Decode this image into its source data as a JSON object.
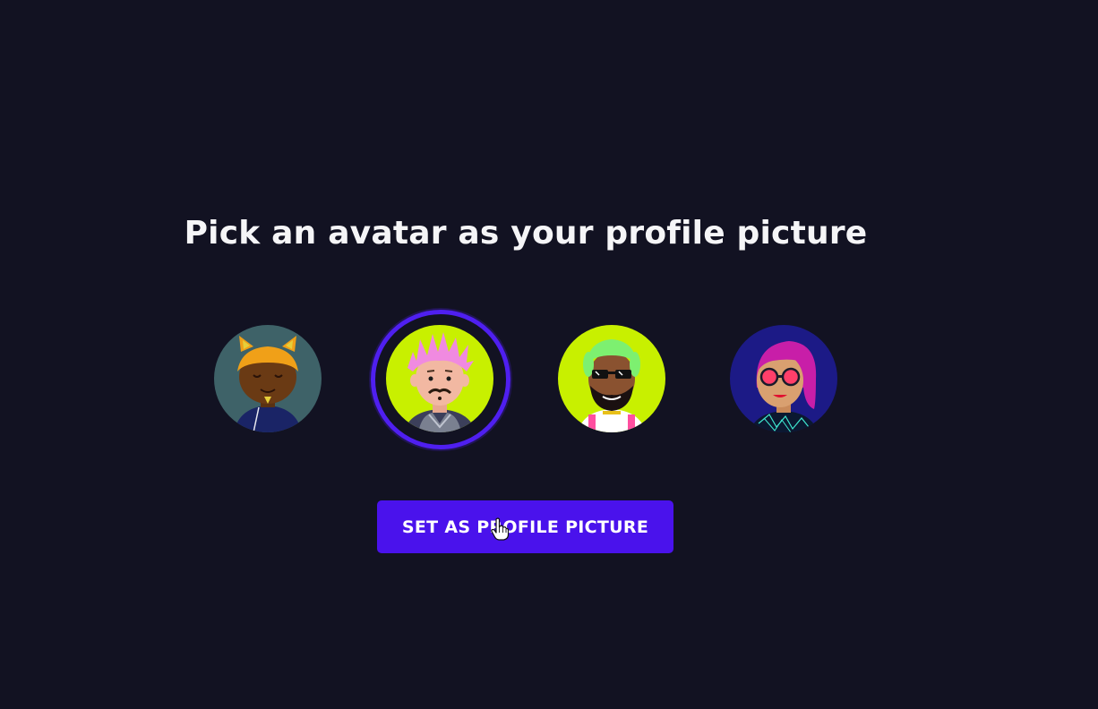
{
  "page": {
    "title": "Pick an avatar as your profile picture"
  },
  "avatars": [
    {
      "name": "avatar-cat-ears",
      "selected": false,
      "bg": "#3e6268"
    },
    {
      "name": "avatar-pink-hair",
      "selected": true,
      "bg": "#c8f000"
    },
    {
      "name": "avatar-sunglasses-beard",
      "selected": false,
      "bg": "#c8f000"
    },
    {
      "name": "avatar-magenta-hair",
      "selected": false,
      "bg": "#1c1a86"
    }
  ],
  "actions": {
    "set_profile_label": "SET AS PROFILE PICTURE"
  },
  "colors": {
    "background": "#121222",
    "accent": "#4a12ec",
    "selection_ring": "#4f1ff0",
    "text": "#f5f5f7"
  },
  "icons": {
    "cursor": "hand-pointer-icon"
  }
}
